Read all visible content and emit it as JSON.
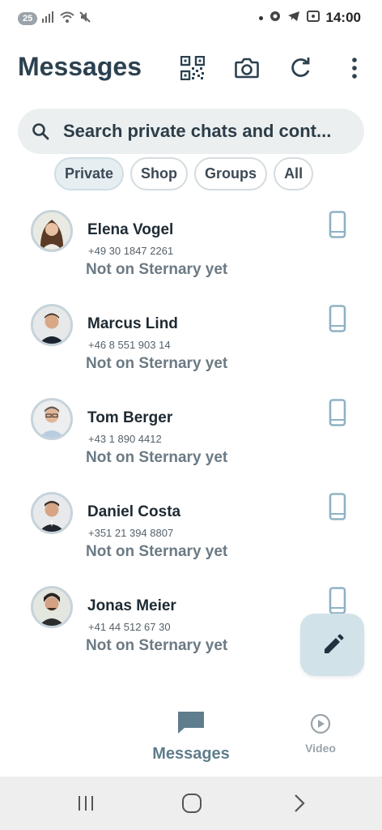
{
  "status_bar": {
    "badge": "25",
    "time": "14:00"
  },
  "header": {
    "title": "Messages",
    "actions": [
      "qr-code-icon",
      "camera-icon",
      "refresh-icon",
      "more-vert-icon"
    ]
  },
  "search": {
    "placeholder": "Search private chats and cont..."
  },
  "filters": [
    {
      "label": "Private",
      "active": true
    },
    {
      "label": "Shop",
      "active": false
    },
    {
      "label": "Groups",
      "active": false
    },
    {
      "label": "All",
      "active": false
    }
  ],
  "contacts": [
    {
      "name": "Elena Vogel",
      "phone": "+49 30 1847 2261",
      "status": "Not on Sternary yet"
    },
    {
      "name": "Marcus Lind",
      "phone": "+46 8 551 903 14",
      "status": "Not on Sternary yet"
    },
    {
      "name": "Tom Berger",
      "phone": "+43 1 890 4412",
      "status": "Not on Sternary yet"
    },
    {
      "name": "Daniel Costa",
      "phone": "+351 21 394 8807",
      "status": "Not on Sternary yet"
    },
    {
      "name": "Jonas Meier",
      "phone": "+41 44 512 67 30",
      "status": "Not on Sternary yet"
    }
  ],
  "bottom_nav": {
    "messages_label": "Messages",
    "video_label": "Video"
  },
  "colors": {
    "accent": "#5f7d8c",
    "fab_background": "#d2e2e9"
  }
}
